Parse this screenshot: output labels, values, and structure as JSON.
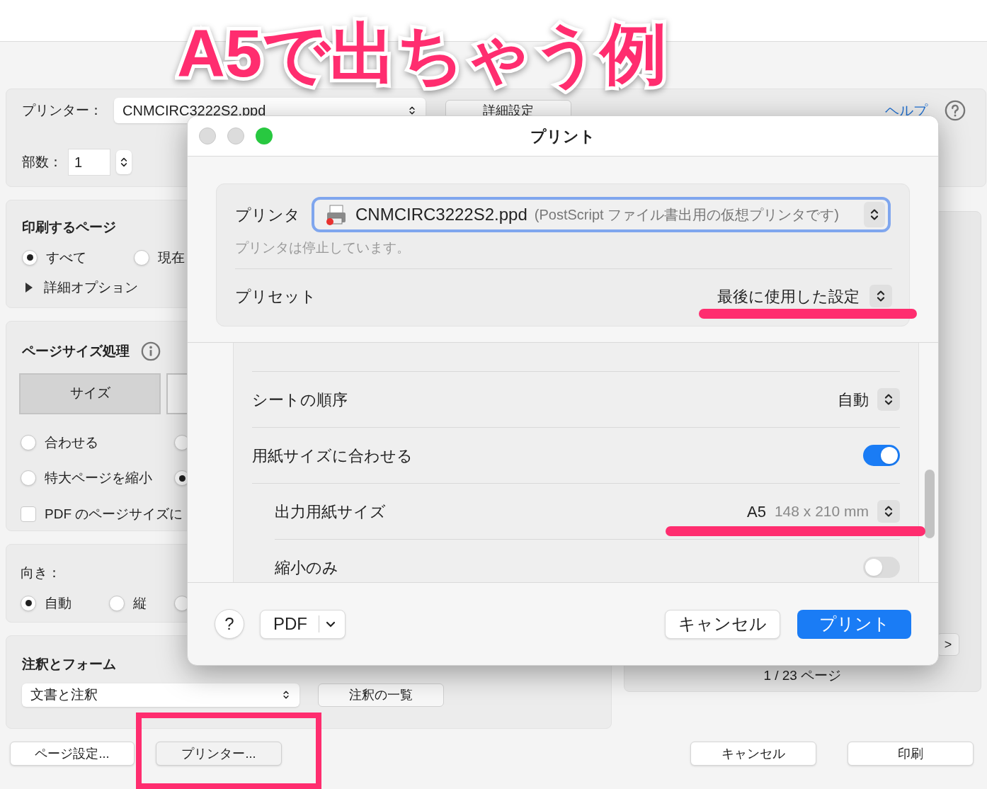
{
  "annotation": {
    "title": "A5で出ちゃう例"
  },
  "background_dialog": {
    "printer": {
      "label": "プリンター：",
      "value": "CNMCIRC3222S2.ppd",
      "advanced_button": "詳細設定",
      "help_link": "ヘルプ"
    },
    "copies": {
      "label": "部数：",
      "value": "1"
    },
    "pages_section": {
      "title": "印刷するページ",
      "options": [
        {
          "label": "すべて",
          "selected": true
        },
        {
          "label": "現在",
          "selected": false
        }
      ],
      "more_options": "詳細オプション"
    },
    "page_sizing": {
      "title": "ページサイズ処理",
      "tabs": [
        {
          "label": "サイズ",
          "selected": true
        },
        {
          "selected": false
        }
      ],
      "options": [
        {
          "label": "合わせる",
          "selected": false
        },
        {
          "selected": false
        },
        {
          "label": "特大ページを縮小",
          "selected": false
        },
        {
          "selected": true
        }
      ],
      "pdf_size_checkbox": {
        "label": "PDF のページサイズに",
        "checked": false
      }
    },
    "orientation": {
      "label": "向き：",
      "options": [
        {
          "label": "自動",
          "selected": true
        },
        {
          "label": "縦",
          "selected": false
        },
        {
          "selected": false
        }
      ]
    },
    "comments": {
      "title": "注釈とフォーム",
      "select": "文書と注釈",
      "summary_button": "注釈の一覧"
    },
    "preview": {
      "next_button": ">",
      "page_count": "1 / 23 ページ"
    },
    "buttons": {
      "page_setup": "ページ設定...",
      "printer": "プリンター...",
      "cancel": "キャンセル",
      "print": "印刷"
    }
  },
  "print_sheet": {
    "title": "プリント",
    "printer": {
      "label": "プリンタ",
      "name": "CNMCIRC3222S2.ppd",
      "description": "(PostScript ファイル書出用の仮想プリンタです)",
      "status": "プリンタは停止しています。"
    },
    "preset": {
      "label": "プリセット",
      "value": "最後に使用した設定"
    },
    "settings": [
      {
        "kind": "select",
        "label": "シートの順序",
        "value": "自動",
        "indented": false
      },
      {
        "kind": "toggle",
        "label": "用紙サイズに合わせる",
        "on": true,
        "indented": false
      },
      {
        "kind": "select",
        "label": "出力用紙サイズ",
        "value": "A5",
        "detail": "148 x 210 mm",
        "indented": true
      },
      {
        "kind": "toggle",
        "label": "縮小のみ",
        "on": false,
        "indented": true
      }
    ],
    "footer": {
      "help": "?",
      "pdf_button": "PDF",
      "cancel": "キャンセル",
      "print": "プリント"
    }
  }
}
